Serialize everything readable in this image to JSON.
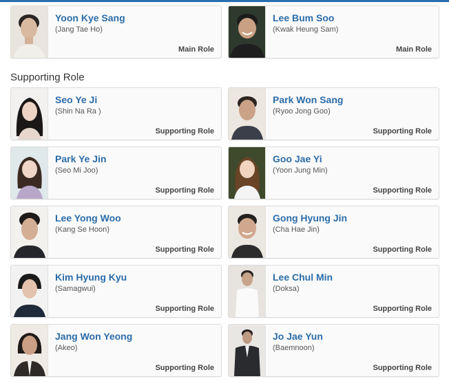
{
  "main_cast": [
    {
      "name": "Yoon Kye Sang",
      "character": "(Jang Tae Ho)",
      "role": "Main Role",
      "photo": "actor-portrait-yoon-kye-sang"
    },
    {
      "name": "Lee Bum Soo",
      "character": "(Kwak Heung Sam)",
      "role": "Main Role",
      "photo": "actor-portrait-lee-bum-soo"
    }
  ],
  "supporting_section": {
    "title": "Supporting Role"
  },
  "supporting_cast": [
    {
      "name": "Seo Ye Ji",
      "character": "(Shin Na Ra )",
      "role": "Supporting Role"
    },
    {
      "name": "Park Won Sang",
      "character": "(Ryoo Jong Goo)",
      "role": "Supporting Role"
    },
    {
      "name": "Park Ye Jin",
      "character": "(Seo Mi Joo)",
      "role": "Supporting Role"
    },
    {
      "name": "Goo Jae Yi",
      "character": "(Yoon Jung Min)",
      "role": "Supporting Role"
    },
    {
      "name": "Lee Yong Woo",
      "character": "(Kang Se Hoon)",
      "role": "Supporting Role"
    },
    {
      "name": "Gong Hyung Jin",
      "character": "(Cha Hae Jin)",
      "role": "Supporting Role"
    },
    {
      "name": "Kim Hyung Kyu",
      "character": "(Samagwui)",
      "role": "Supporting Role"
    },
    {
      "name": "Lee Chul Min",
      "character": "(Doksa)",
      "role": "Supporting Role"
    },
    {
      "name": "Jang Won Yeong",
      "character": "(Akeo)",
      "role": "Supporting Role"
    },
    {
      "name": "Jo Jae Yun",
      "character": "(Baemnoon)",
      "role": "Supporting Role"
    }
  ],
  "colors": {
    "accent": "#2a6fb0",
    "name_link": "#2b6ca8",
    "card_border": "#dcdcdc"
  }
}
